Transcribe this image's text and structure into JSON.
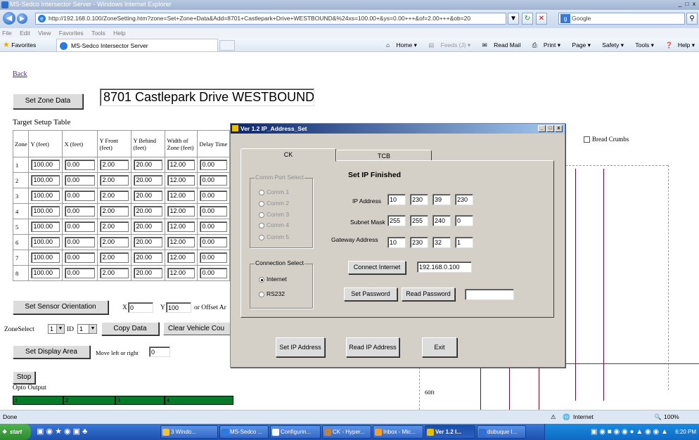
{
  "window": {
    "title": "MS-Sedco Intersector Server - Windows Internet Explorer",
    "min": "_",
    "max": "□",
    "close": "x"
  },
  "address": {
    "url": "http://192.168.0.100/ZoneSetting.htm?zone=Set+Zone+Data&Add=8701+Castlepark+Drive+WESTBOUND&%24xs=100.00+&ys=0.00+++&of=2.00+++&ob=20",
    "search_placeholder": "Google"
  },
  "menu": [
    "File",
    "Edit",
    "View",
    "Favorites",
    "Tools",
    "Help"
  ],
  "favorites": {
    "label": "Favorites",
    "tab": "MS-Sedco Intersector Server",
    "commands": [
      "Home",
      "Feeds (J)",
      "Read Mail",
      "Print",
      "Page",
      "Safety",
      "Tools",
      "Help"
    ]
  },
  "page": {
    "back_link": "Back",
    "set_zone_button": "Set Zone Data",
    "zone_name": "8701 Castlepark Drive WESTBOUND",
    "table_title": "Target Setup Table",
    "columns": [
      "Zone",
      "Y (feet)",
      "X (feet)",
      "Y Front (feet)",
      "Y Behind (feet)",
      "Width of Zone (feet)",
      "Delay Time"
    ],
    "rows": [
      [
        "1",
        "100.00",
        "0.00",
        "2.00",
        "20.00",
        "12.00",
        "0.00"
      ],
      [
        "2",
        "100.00",
        "0.00",
        "2.00",
        "20.00",
        "12.00",
        "0.00"
      ],
      [
        "3",
        "100.00",
        "0.00",
        "2.00",
        "20.00",
        "12.00",
        "0.00"
      ],
      [
        "4",
        "100.00",
        "0.00",
        "2.00",
        "20.00",
        "12.00",
        "0.00"
      ],
      [
        "5",
        "100.00",
        "0.00",
        "2.00",
        "20.00",
        "12.00",
        "0.00"
      ],
      [
        "6",
        "100.00",
        "0.00",
        "2.00",
        "20.00",
        "12.00",
        "0.00"
      ],
      [
        "7",
        "100.00",
        "0.00",
        "2.00",
        "20.00",
        "12.00",
        "0.00"
      ],
      [
        "8",
        "100.00",
        "0.00",
        "2.00",
        "20.00",
        "12.00",
        "0.00"
      ]
    ],
    "sensor_orientation_button": "Set Sensor Orientation",
    "x_label": "X",
    "x_value": "0",
    "y_label": "Y",
    "y_value": "100",
    "offset_label": "or Offset Ar",
    "zoneselect_label": "ZoneSelect",
    "zoneselect_value": "1",
    "id_label": "ID",
    "id_value": "1",
    "copy_data_button": "Copy Data",
    "clear_vehicle_button": "Clear Vehicle Cou",
    "display_area_button": "Set Display Area",
    "move_label": "Move left or right",
    "move_value": "0",
    "stop_button": "Stop",
    "opto_label": "Opto Output",
    "opto_outputs": [
      "1",
      "2",
      "3",
      "4"
    ],
    "bread_crumbs_label": "Bread Crumbs",
    "distance_label": "60ft"
  },
  "dialog": {
    "title": "Ver 1.2 IP_Address_Set",
    "tabs": [
      "CK",
      "TCB"
    ],
    "status": "Set IP Finished",
    "comm_group_label": "Comm Port Select",
    "comm_ports": [
      "Comm 1",
      "Comm 2",
      "Comm 3",
      "Comm 4",
      "Comm 5"
    ],
    "ip_label": "IP Address",
    "ip": [
      "10",
      "230",
      "39",
      "230"
    ],
    "subnet_label": "Subnet Mask",
    "subnet": [
      "255",
      "255",
      "240",
      "0"
    ],
    "gateway_label": "Gateway Address",
    "gateway": [
      "10",
      "230",
      "32",
      "1"
    ],
    "connection_group_label": "Connection Select",
    "connection_options": [
      "Internet",
      "RS232"
    ],
    "connect_button": "Connect Internet",
    "connect_ip": "192.168.0.100",
    "set_password_button": "Set Password",
    "read_password_button": "Read Password",
    "password_value": "",
    "set_ip_button": "Set IP Address",
    "read_ip_button": "Read IP Address",
    "exit_button": "Exit"
  },
  "status": {
    "left": "Done",
    "zone": "Internet",
    "zoom": "100%"
  },
  "taskbar": {
    "start": "start",
    "items": [
      "3 Windo...",
      "MS-Sedco ...",
      "Configurin...",
      "CK - Hyper...",
      "Inbox - Mic...",
      "Ver 1.2 I...",
      "dubuque I..."
    ],
    "clock": "6:20 PM"
  },
  "colors": {
    "opto_green": "#0a7a2a",
    "dialog_title": "#0a246a",
    "lane_line": "#800028"
  }
}
